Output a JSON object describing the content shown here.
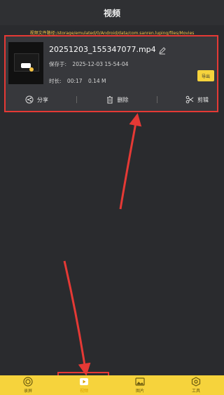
{
  "header": {
    "title": "视频"
  },
  "path_text": "视频文件路径:/storage/emulated/0/Android/data/com.sanren.luping/files/Movies",
  "video": {
    "file_name": "20251203_155347077.mp4",
    "saved_label": "保存于:",
    "saved_at": "2025-12-03 15-54-04",
    "duration_label": "时长:",
    "duration": "00:17",
    "size": "0.14 M",
    "export_label": "导出"
  },
  "actions": {
    "share_label": "分享",
    "delete_label": "删除",
    "edit_label": "剪辑"
  },
  "tabs": [
    {
      "label": "录屏",
      "icon": "record-icon"
    },
    {
      "label": "视频",
      "icon": "video-play-icon"
    },
    {
      "label": "图片",
      "icon": "image-icon"
    },
    {
      "label": "工具",
      "icon": "tools-icon"
    }
  ],
  "colors": {
    "background": "#2a2b2e",
    "accent": "#f6d33c",
    "highlight": "#e53935"
  }
}
